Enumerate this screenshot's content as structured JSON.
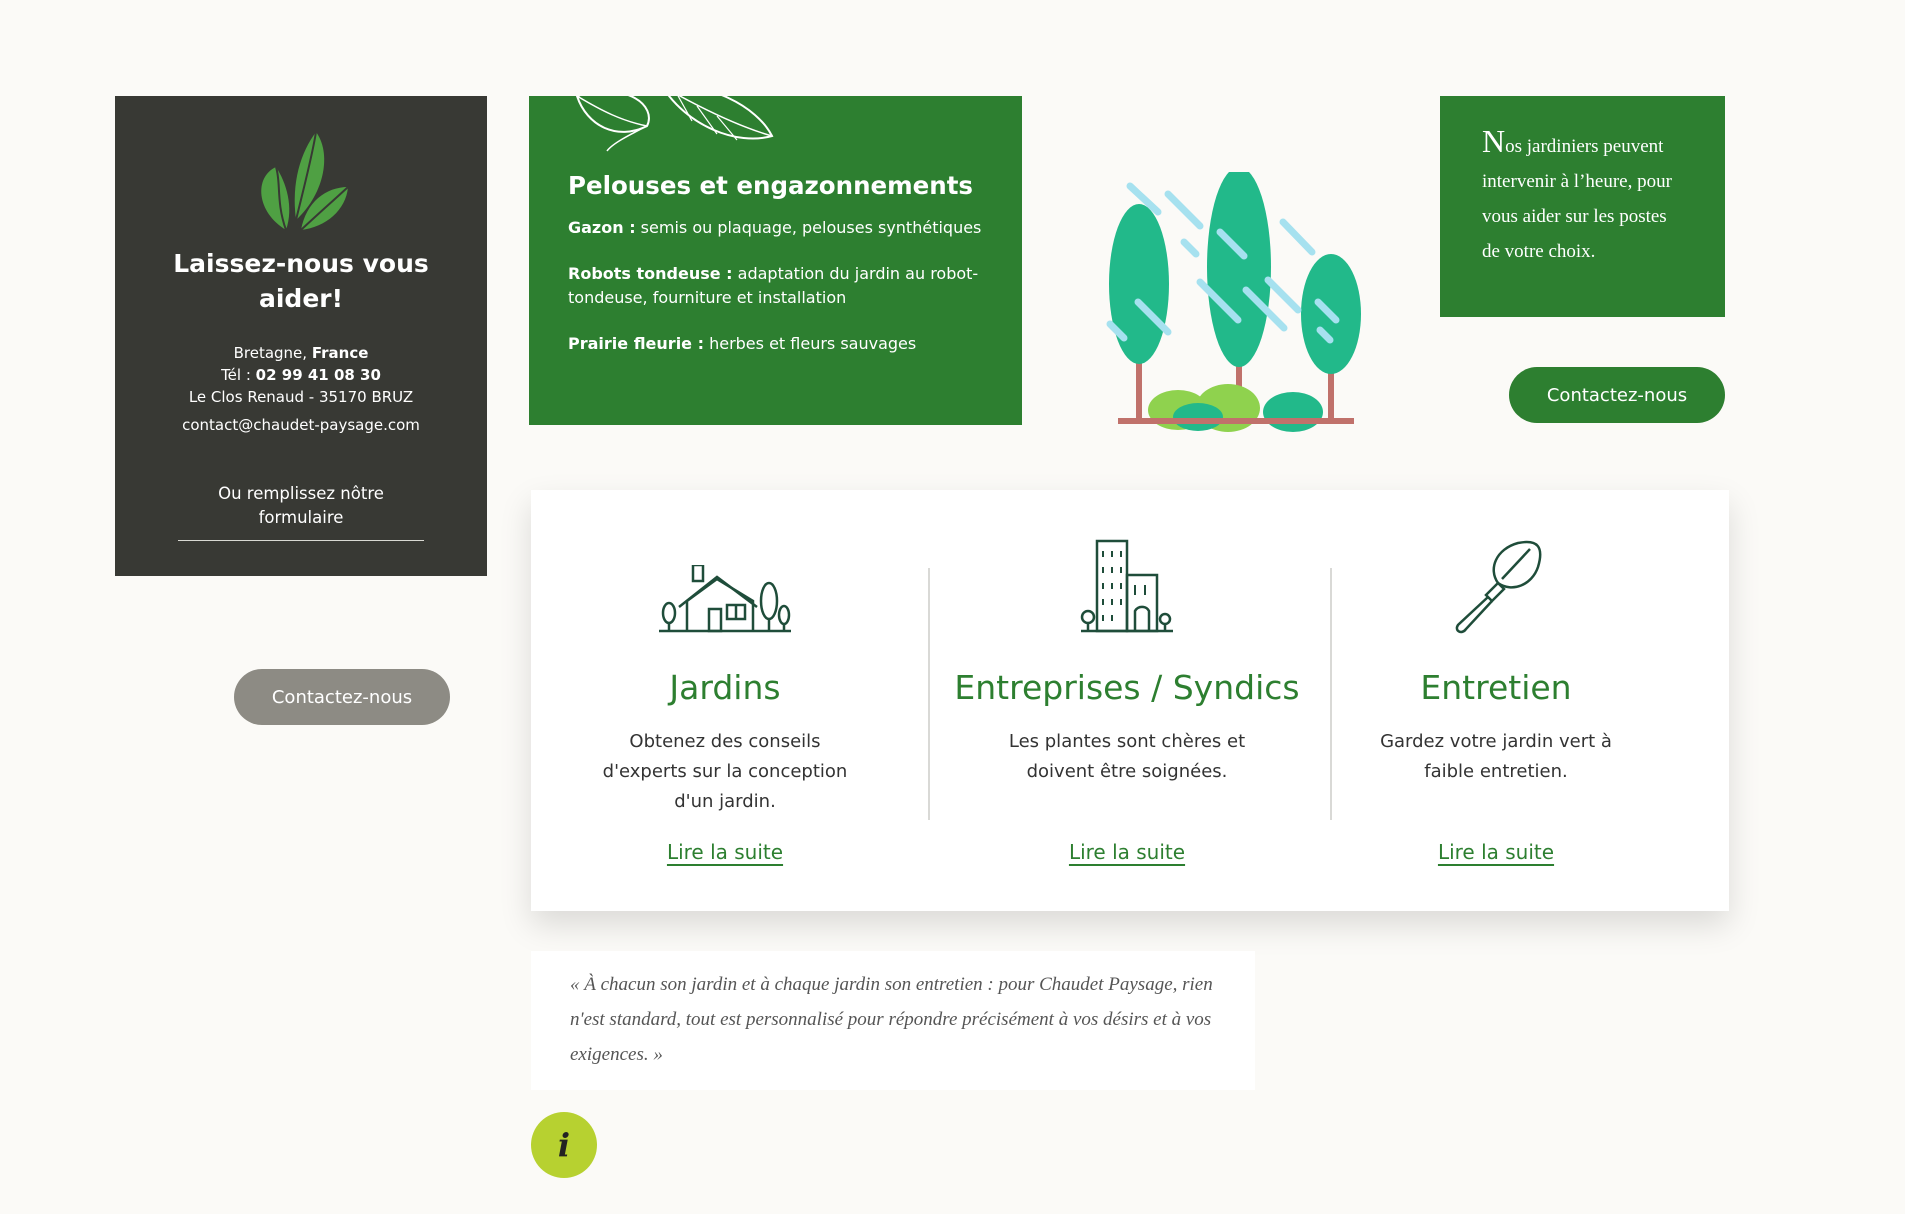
{
  "contact_card": {
    "title": "Laissez-nous vous aider!",
    "region": "Bretagne, ",
    "region_bold": "France",
    "phone_label": "Tél : ",
    "phone": "02 99 41 08 30",
    "address": "Le Clos Renaud - 35170 BRUZ",
    "email": "contact@chaudet-paysage.com",
    "form_link": "Ou remplissez nôtre formulaire",
    "leaf_icon": "leaf-logo-icon"
  },
  "contact_button_grey": "Contactez-nous",
  "lawn_card": {
    "title": "Pelouses et engazonnements",
    "items": [
      {
        "label": "Gazon :",
        "text": " semis ou plaquage, pelouses synthétiques"
      },
      {
        "label": "Robots tondeuse :",
        "text": " adaptation du jardin au robot-tondeuse, fourniture et installation"
      },
      {
        "label": "Prairie fleurie :",
        "text": " herbes et fleurs sauvages"
      }
    ]
  },
  "note_card": {
    "dropcap": "N",
    "text": "os jardiniers peuvent intervenir à l’heure, pour vous aider sur les postes de votre choix."
  },
  "contact_button_green": "Contactez-nous",
  "services": [
    {
      "icon": "house-icon",
      "title": "Jardins",
      "desc": "Obtenez des conseils d'experts sur la conception d'un jardin.",
      "link": "Lire la suite"
    },
    {
      "icon": "building-icon",
      "title": "Entreprises / Syndics",
      "desc": "Les plantes sont chères et doivent être soignées.",
      "link": "Lire la suite"
    },
    {
      "icon": "trowel-icon",
      "title": "Entretien",
      "desc": "Gardez votre jardin vert à faible entretien.",
      "link": "Lire la suite"
    }
  ],
  "quote": "« À chacun son jardin et à chaque jardin son entretien : pour Chaudet Paysage, rien n'est standard, tout est personnalisé pour répondre précisément à vos désirs et à vos exigences. »",
  "info_button": "i",
  "colors": {
    "green": "#2d7f30",
    "dark": "#383934",
    "grey_button": "#8d8b84",
    "lime": "#b7d130",
    "background": "#fbfaf7"
  }
}
